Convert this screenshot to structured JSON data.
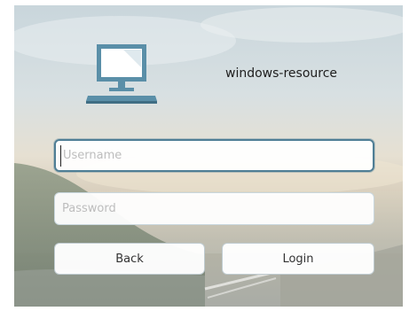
{
  "app": {
    "name": "windows-resource",
    "icon": "computer-monitor-icon"
  },
  "form": {
    "username_placeholder": "Username",
    "username_value": "",
    "password_placeholder": "Password",
    "password_value": ""
  },
  "buttons": {
    "back_label": "Back",
    "login_label": "Login"
  },
  "colors": {
    "accent": "#4f7e95",
    "icon_fill": "#5a8fa8",
    "text": "#1e1e1e",
    "placeholder": "#bdbdbd"
  }
}
